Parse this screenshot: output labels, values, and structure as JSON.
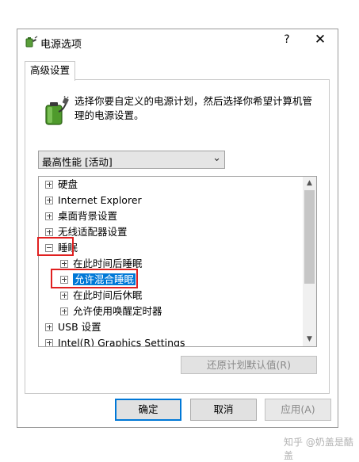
{
  "window": {
    "title": "电源选项",
    "help_label": "?",
    "close_label": "✕",
    "icon": "power-options-icon"
  },
  "tab": {
    "label": "高级设置"
  },
  "description": {
    "icon": "battery-plug-icon",
    "text": "选择你要自定义的电源计划，然后选择你希望计算机管理的电源设置。"
  },
  "plan_select": {
    "value": "最高性能 [活动]"
  },
  "tree": {
    "items": [
      {
        "label": "硬盘",
        "state": "collapsed",
        "level": 0
      },
      {
        "label": "Internet Explorer",
        "state": "collapsed",
        "level": 0
      },
      {
        "label": "桌面背景设置",
        "state": "collapsed",
        "level": 0
      },
      {
        "label": "无线适配器设置",
        "state": "collapsed",
        "level": 0
      },
      {
        "label": "睡眠",
        "state": "expanded",
        "level": 0
      },
      {
        "label": "在此时间后睡眠",
        "state": "collapsed",
        "level": 1
      },
      {
        "label": "允许混合睡眠",
        "state": "collapsed",
        "level": 1,
        "selected": true
      },
      {
        "label": "在此时间后休眠",
        "state": "collapsed",
        "level": 1
      },
      {
        "label": "允许使用唤醒定时器",
        "state": "collapsed",
        "level": 1
      },
      {
        "label": "USB 设置",
        "state": "collapsed",
        "level": 0
      },
      {
        "label": "Intel(R) Graphics Settings",
        "state": "collapsed",
        "level": 0
      }
    ]
  },
  "restore_button": {
    "label": "还原计划默认值(R)"
  },
  "buttons": {
    "ok": "确定",
    "cancel": "取消",
    "apply": "应用(A)"
  },
  "watermark": "知乎 @奶盖是酷盖",
  "colors": {
    "selection": "#0078d7",
    "highlight_box": "#e02020",
    "default_button_border": "#0078d7"
  }
}
